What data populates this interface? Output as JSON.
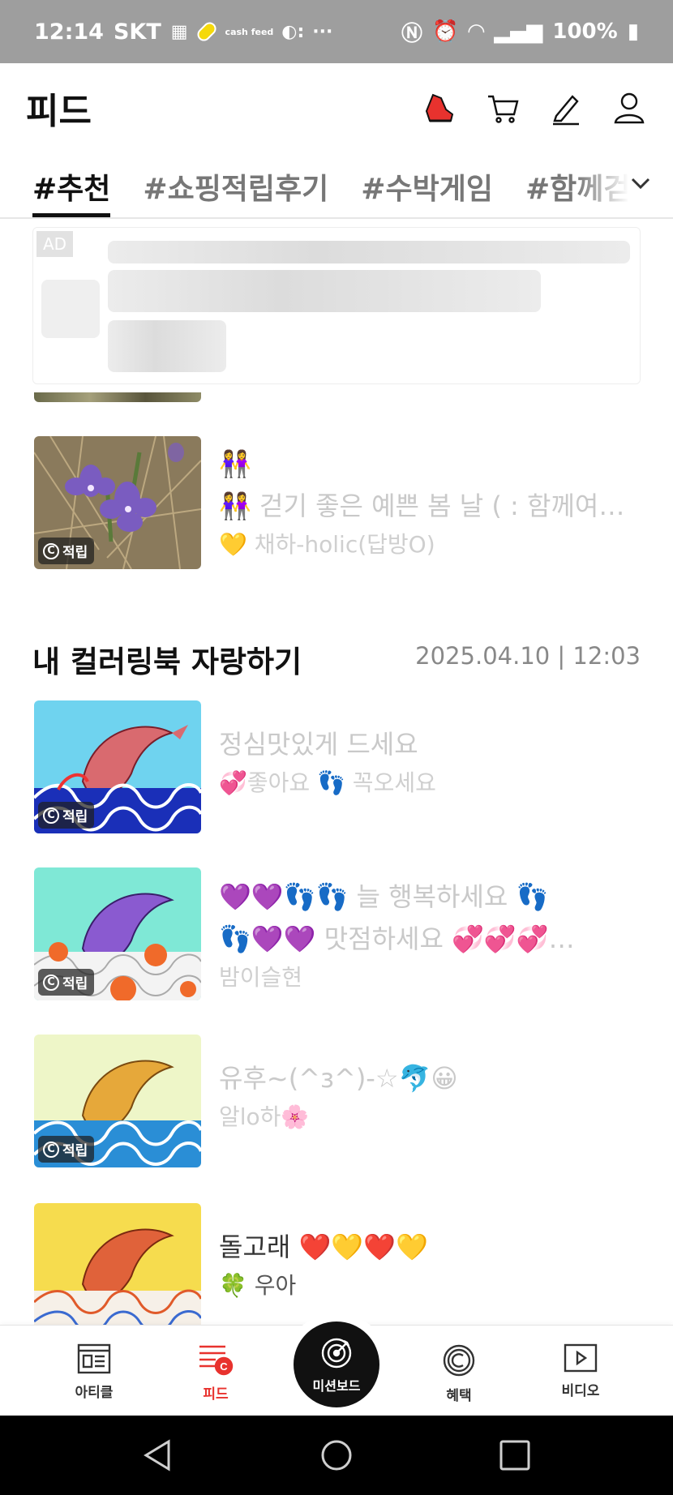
{
  "status_bar": {
    "time": "12:14",
    "carrier": "SKT",
    "cashfeed_label": "cash feed",
    "overflow": "···",
    "battery": "100%"
  },
  "header": {
    "title": "피드"
  },
  "tabs": [
    {
      "label": "#추천",
      "active": true
    },
    {
      "label": "#쇼핑적립후기",
      "active": false
    },
    {
      "label": "#수박게임",
      "active": false
    },
    {
      "label": "#함께걷기인증",
      "active": false
    }
  ],
  "ad": {
    "badge": "AD"
  },
  "feed_top": [
    {
      "line1": "👭",
      "line2": "👭 걷기 좋은 예쁜 봄 날 ( : 함께여…",
      "author": "💛 채하-holic(답방O)",
      "badge": "적립"
    }
  ],
  "section": {
    "title": "내 컬러링북 자랑하기",
    "date": "2025.04.10 | 12:03"
  },
  "feed_section": [
    {
      "line1": "정심맛있게 드세요",
      "author": "💞좋아요 👣 꼭오세요",
      "badge": "적립"
    },
    {
      "line1": "💜💜👣👣   늘  행복하세요    👣",
      "line2": "👣💜💜    맛점하세요    💞💞💞…",
      "author": "밤이슬현",
      "badge": "적립"
    },
    {
      "line1": "유후~(^з^)-☆🐬😀",
      "author": "알lo하🌸",
      "badge": "적립"
    },
    {
      "line1": "돌고래 ❤️💛❤️💛",
      "author": "🍀 우아"
    }
  ],
  "bottom_nav": {
    "article": "아티클",
    "feed": "피드",
    "mission": "미션보드",
    "benefit": "혜택",
    "video": "비디오"
  },
  "colors": {
    "accent": "#e8322e",
    "status_bar": "#9e9e9e"
  }
}
